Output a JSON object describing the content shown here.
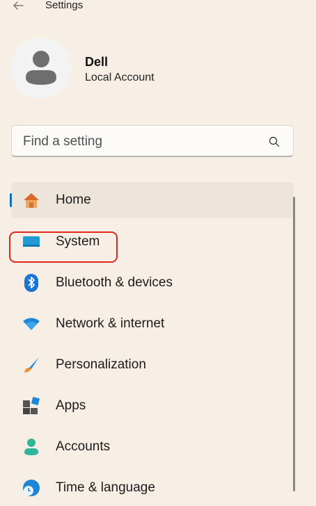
{
  "window": {
    "title": "Settings"
  },
  "user": {
    "name": "Dell",
    "account_type": "Local Account"
  },
  "search": {
    "placeholder": "Find a setting"
  },
  "nav": {
    "items": [
      {
        "label": "Home",
        "icon": "home-icon",
        "selected": true
      },
      {
        "label": "System",
        "icon": "system-icon",
        "selected": false
      },
      {
        "label": "Bluetooth & devices",
        "icon": "bluetooth-icon",
        "selected": false
      },
      {
        "label": "Network & internet",
        "icon": "network-icon",
        "selected": false
      },
      {
        "label": "Personalization",
        "icon": "brush-icon",
        "selected": false
      },
      {
        "label": "Apps",
        "icon": "apps-icon",
        "selected": false
      },
      {
        "label": "Accounts",
        "icon": "accounts-icon",
        "selected": false
      },
      {
        "label": "Time & language",
        "icon": "globe-clock-icon",
        "selected": false
      }
    ]
  },
  "colors": {
    "background": "#f7efe6",
    "accent": "#0f6fb3",
    "highlight_box": "#e1261c"
  }
}
